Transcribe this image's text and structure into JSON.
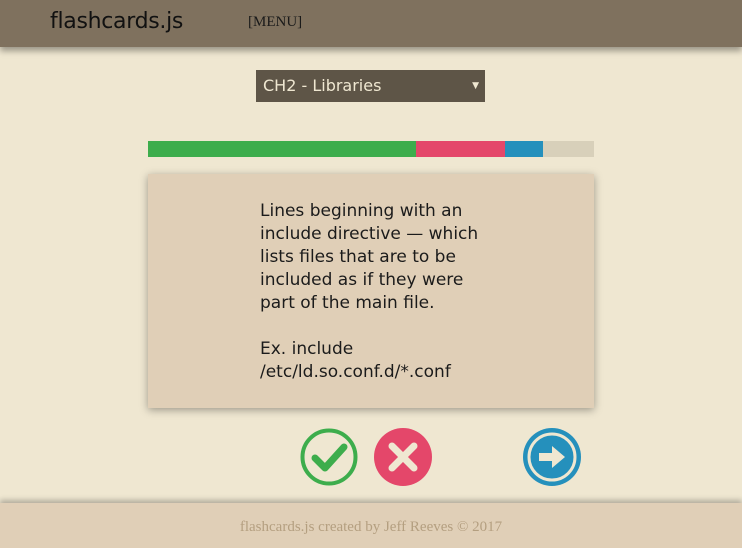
{
  "header": {
    "brand": "flashcards.js",
    "menu_label": "[MENU]"
  },
  "deck_select": {
    "selected": "CH2 - Libraries",
    "arrow_icon": "triangle-down-icon"
  },
  "progress": {
    "correct_fraction": 0.6,
    "wrong_fraction": 0.2,
    "skipped_fraction": 0.085,
    "colors": {
      "correct": "#3dad4c",
      "wrong": "#e4476a",
      "skipped": "#2590bc",
      "remaining": "#d8d0ba"
    }
  },
  "card": {
    "definition": "Lines beginning with an include directive — which lists files that are to be included as if they were part of the main file.",
    "example": "Ex. include /etc/ld.so.conf.d/*.conf"
  },
  "controls": {
    "correct_icon": "checkmark-circle-icon",
    "wrong_icon": "x-circle-icon",
    "next_icon": "arrow-right-circle-icon",
    "correct_color": "#3dad4c",
    "wrong_color": "#e4476a",
    "next_color": "#2590bc"
  },
  "footer": {
    "text": "flashcards.js created by Jeff Reeves © 2017"
  }
}
